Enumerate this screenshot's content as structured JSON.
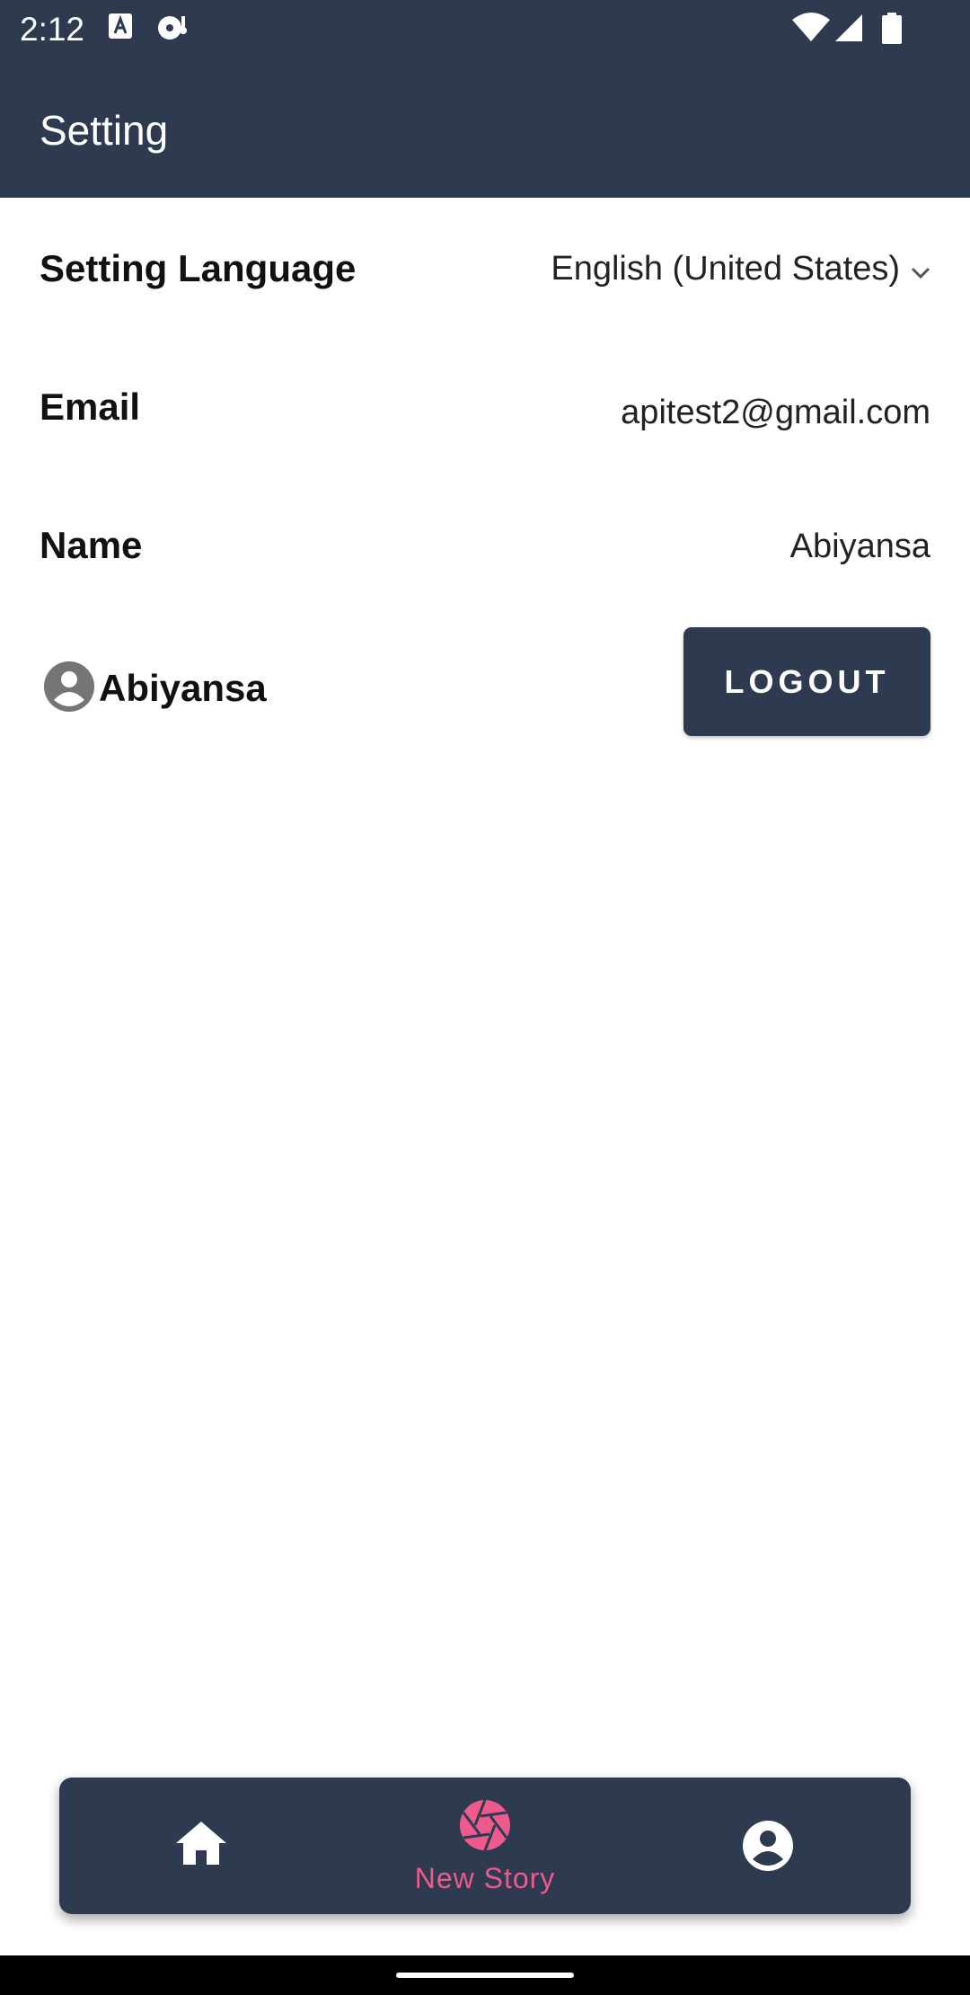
{
  "status_bar": {
    "time": "2:12",
    "icons": [
      "font-a-icon",
      "media-disc-icon",
      "wifi-icon",
      "signal-icon",
      "battery-icon"
    ]
  },
  "app_bar": {
    "title": "Setting"
  },
  "settings": {
    "language": {
      "label": "Setting Language",
      "selected": "English (United States)"
    },
    "email": {
      "label": "Email",
      "value": "apitest2@gmail.com"
    },
    "name": {
      "label": "Name",
      "value": "Abiyansa"
    }
  },
  "profile": {
    "username": "Abiyansa",
    "logout_label": "LOGOUT"
  },
  "bottom_nav": {
    "items": [
      {
        "icon": "home-icon",
        "label": ""
      },
      {
        "icon": "camera-shutter-icon",
        "label": "New Story",
        "active": true
      },
      {
        "icon": "account-circle-icon",
        "label": ""
      }
    ]
  },
  "colors": {
    "primary": "#2e3a4f",
    "accent": "#ec5b8b",
    "on_primary": "#ffffff"
  }
}
